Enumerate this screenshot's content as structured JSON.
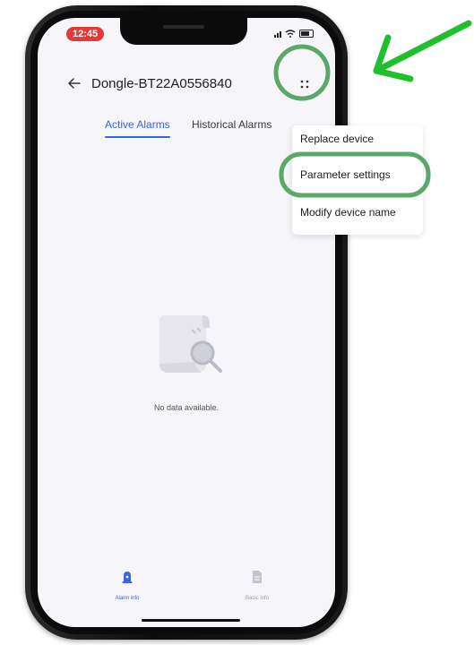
{
  "status_bar": {
    "time": "12:45"
  },
  "header": {
    "title": "Dongle-BT22A0556840"
  },
  "tabs": [
    {
      "label": "Active Alarms",
      "active": true
    },
    {
      "label": "Historical Alarms",
      "active": false
    }
  ],
  "menu": {
    "items": [
      {
        "label": "Replace device"
      },
      {
        "label": "Parameter settings",
        "highlighted": true
      },
      {
        "label": "Modify device name"
      }
    ]
  },
  "empty_state": {
    "text": "No data available."
  },
  "bottom_nav": {
    "items": [
      {
        "label": "Alarm info",
        "active": true,
        "icon": "alarm-bell-icon"
      },
      {
        "label": "Basic info",
        "active": false,
        "icon": "document-icon"
      }
    ]
  },
  "colors": {
    "accent": "#3564e6",
    "annotation_green": "#5aa86a",
    "arrow_green": "#1fbf2e",
    "time_pill": "#e53935"
  }
}
